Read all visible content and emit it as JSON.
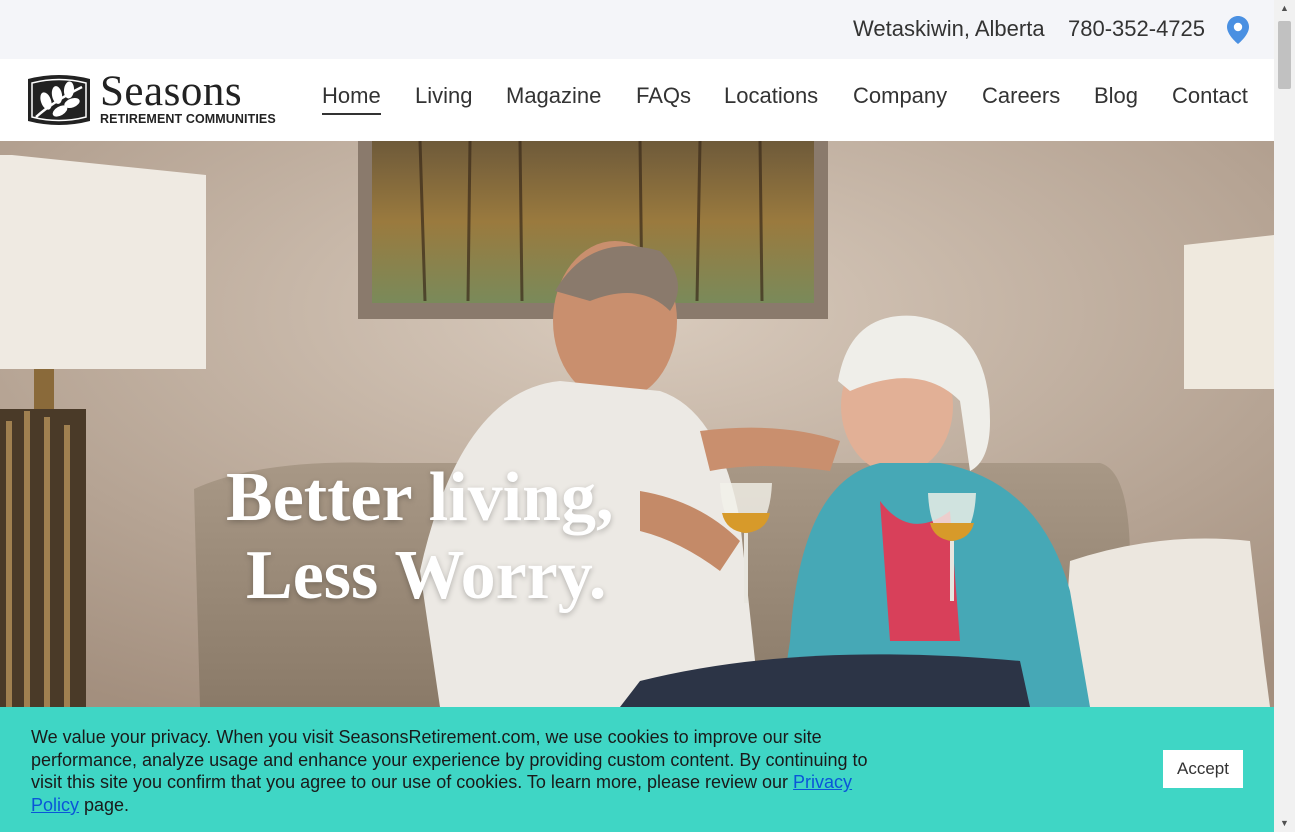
{
  "topbar": {
    "city": "Wetaskiwin, Alberta",
    "phone": "780-352-4725",
    "pin_icon": "map-pin-icon",
    "pin_color": "#4a90e2"
  },
  "logo": {
    "name": "Seasons",
    "tagline": "RETIREMENT COMMUNITIES"
  },
  "nav": {
    "items": [
      {
        "label": "Home",
        "active": true
      },
      {
        "label": "Living"
      },
      {
        "label": "Magazine"
      },
      {
        "label": "FAQs"
      },
      {
        "label": "Locations"
      },
      {
        "label": "Company"
      },
      {
        "label": "Careers"
      },
      {
        "label": "Blog"
      },
      {
        "label": "Contact"
      }
    ]
  },
  "hero": {
    "line1": "Better living,",
    "line2": "Less Worry."
  },
  "cookie": {
    "text": "We value your privacy. When you visit SeasonsRetirement.com, we use cookies to improve our site performance, analyze usage and enhance your experience by providing custom content. By continuing to visit this site you confirm that you agree to our use of cookies. To learn more, please review our ",
    "link": "Privacy Policy",
    "suffix": " page.",
    "accept": "Accept",
    "bg_color": "#3fd6c5"
  },
  "scrollbar": {
    "up_icon": "scroll-up-arrow-icon",
    "down_icon": "scroll-down-arrow-icon"
  }
}
